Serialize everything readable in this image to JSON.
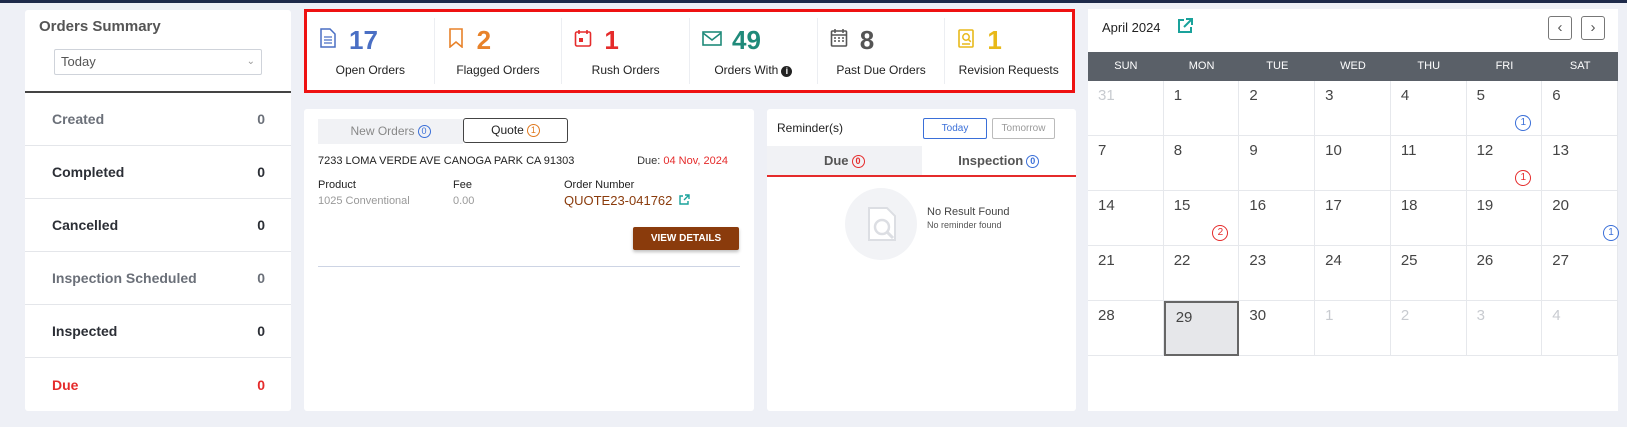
{
  "summary": {
    "title": "Orders Summary",
    "filter": "Today",
    "rows": [
      {
        "label": "Created",
        "value": "0",
        "color": "gray"
      },
      {
        "label": "Completed",
        "value": "0",
        "color": "dark"
      },
      {
        "label": "Cancelled",
        "value": "0",
        "color": "dark"
      },
      {
        "label": "Inspection Scheduled",
        "value": "0",
        "color": "gray"
      },
      {
        "label": "Inspected",
        "value": "0",
        "color": "dark"
      },
      {
        "label": "Due",
        "value": "0",
        "color": "red"
      }
    ]
  },
  "stats": [
    {
      "value": "17",
      "label": "Open Orders",
      "color": "#4a6fc4",
      "icon": "document-icon"
    },
    {
      "value": "2",
      "label": "Flagged Orders",
      "color": "#e8822a",
      "icon": "bookmark-icon"
    },
    {
      "value": "1",
      "label": "Rush Orders",
      "color": "#e52b2b",
      "icon": "calendar-rush-icon"
    },
    {
      "value": "49",
      "label": "Orders With",
      "color": "#1f8a7a",
      "icon": "envelope-icon"
    },
    {
      "value": "8",
      "label": "Past Due Orders",
      "color": "#555555",
      "icon": "calendar-grid-icon"
    },
    {
      "value": "1",
      "label": "Revision Requests",
      "color": "#e8b91a",
      "icon": "revision-icon"
    }
  ],
  "orders": {
    "tab_new": "New Orders",
    "tab_new_count": "0",
    "tab_quote": "Quote",
    "tab_quote_count": "1",
    "address": "7233 LOMA VERDE AVE CANOGA PARK CA 91303",
    "due_label": "Due:",
    "due_date": "04 Nov, 2024",
    "product_label": "Product",
    "product_value": "1025 Conventional",
    "fee_label": "Fee",
    "fee_value": "0.00",
    "order_number_label": "Order Number",
    "order_number": "QUOTE23-041762",
    "view_details": "VIEW DETAILS"
  },
  "reminders": {
    "title": "Reminder(s)",
    "btn_today": "Today",
    "btn_tomorrow": "Tomorrow",
    "tab_due": "Due",
    "tab_due_count": "0",
    "tab_inspection": "Inspection",
    "tab_inspection_count": "0",
    "empty_title": "No Result Found",
    "empty_sub": "No reminder found"
  },
  "calendar": {
    "title": "April 2024",
    "weekdays": [
      "SUN",
      "MON",
      "TUE",
      "WED",
      "THU",
      "FRI",
      "SAT"
    ],
    "days": [
      {
        "d": "31",
        "other": true
      },
      {
        "d": "1"
      },
      {
        "d": "2"
      },
      {
        "d": "3"
      },
      {
        "d": "4"
      },
      {
        "d": "5",
        "badge": "1",
        "badge_color": "blue"
      },
      {
        "d": "6"
      },
      {
        "d": "7"
      },
      {
        "d": "8"
      },
      {
        "d": "9"
      },
      {
        "d": "10"
      },
      {
        "d": "11"
      },
      {
        "d": "12",
        "badge": "1",
        "badge_color": "red"
      },
      {
        "d": "13"
      },
      {
        "d": "14"
      },
      {
        "d": "15",
        "badge": "2",
        "badge_color": "red"
      },
      {
        "d": "16"
      },
      {
        "d": "17"
      },
      {
        "d": "18"
      },
      {
        "d": "19"
      },
      {
        "d": "20",
        "badge": "1",
        "badge_color": "blue",
        "edge": true
      },
      {
        "d": "21"
      },
      {
        "d": "22"
      },
      {
        "d": "23"
      },
      {
        "d": "24"
      },
      {
        "d": "25"
      },
      {
        "d": "26"
      },
      {
        "d": "27"
      },
      {
        "d": "28"
      },
      {
        "d": "29",
        "today": true
      },
      {
        "d": "30"
      },
      {
        "d": "1",
        "other": true
      },
      {
        "d": "2",
        "other": true
      },
      {
        "d": "3",
        "other": true
      },
      {
        "d": "4",
        "other": true
      }
    ]
  }
}
